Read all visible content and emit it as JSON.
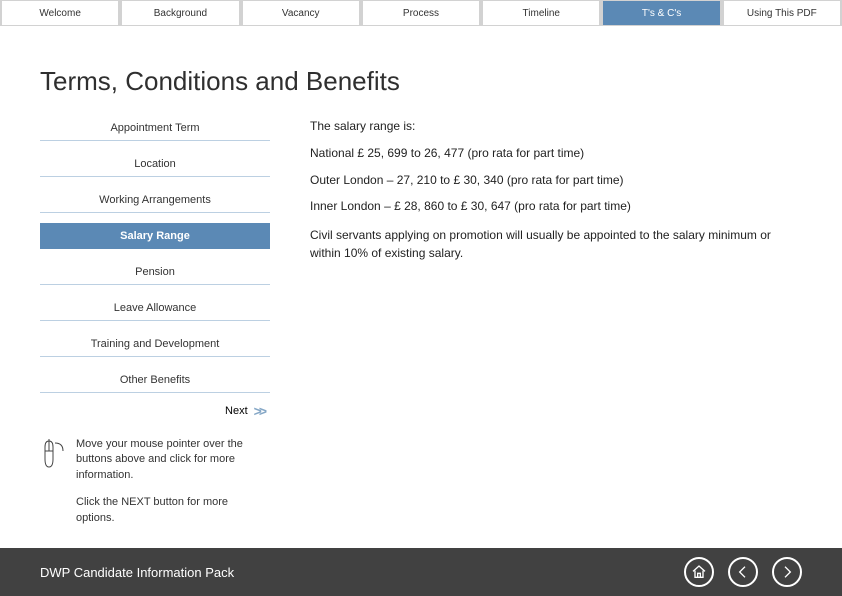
{
  "nav": {
    "tabs": [
      {
        "label": "Welcome",
        "active": false
      },
      {
        "label": "Background",
        "active": false
      },
      {
        "label": "Vacancy",
        "active": false
      },
      {
        "label": "Process",
        "active": false
      },
      {
        "label": "Timeline",
        "active": false
      },
      {
        "label": "T's & C's",
        "active": true
      },
      {
        "label": "Using This PDF",
        "active": false
      }
    ]
  },
  "page_title": "Terms, Conditions and Benefits",
  "sidemenu": {
    "items": [
      {
        "label": "Appointment Term",
        "active": false
      },
      {
        "label": "Location",
        "active": false
      },
      {
        "label": "Working Arrangements",
        "active": false
      },
      {
        "label": "Salary Range",
        "active": true
      },
      {
        "label": "Pension",
        "active": false
      },
      {
        "label": "Leave Allowance",
        "active": false
      },
      {
        "label": "Training and Development",
        "active": false
      },
      {
        "label": "Other Benefits",
        "active": false
      }
    ],
    "next_label": "Next"
  },
  "hints": {
    "line1": "Move your mouse pointer over the buttons above and click for more information.",
    "line2": "Click the NEXT button for more options."
  },
  "content": {
    "p1": "The salary range is:",
    "p2": "National £ 25, 699 to 26, 477 (pro rata for part time)",
    "p3": "Outer London – 27, 210 to £ 30, 340 (pro rata for part time)",
    "p4": "Inner London – £ 28, 860 to £ 30, 647 (pro rata for part time)",
    "p5": "Civil servants applying on promotion will usually be appointed to the salary minimum or within 10% of existing salary."
  },
  "footer": {
    "title": "DWP Candidate Information Pack"
  }
}
